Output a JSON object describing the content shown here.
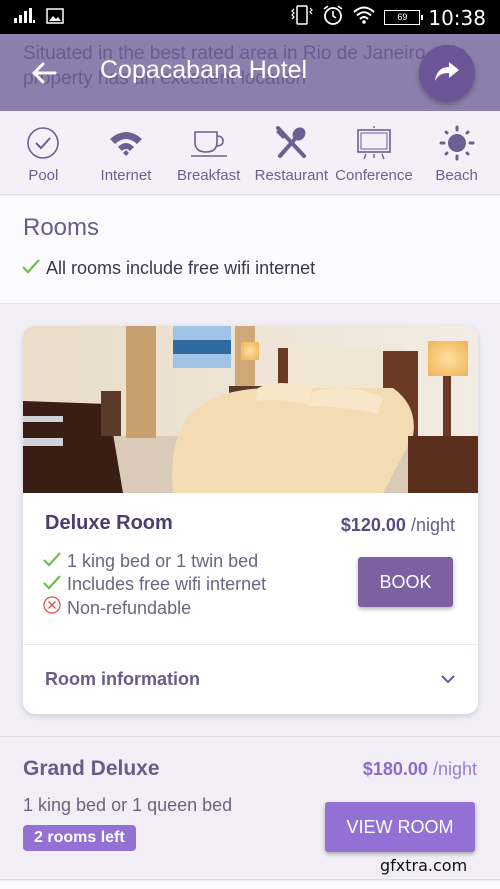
{
  "status_bar": {
    "time": "10:38",
    "battery": "69",
    "icons": [
      "signal-icon",
      "image-notification-icon",
      "vibrate-icon",
      "alarm-icon",
      "wifi-icon",
      "battery-icon"
    ]
  },
  "app_bar": {
    "title": "Copacabana Hotel",
    "behind_text": "Situated in the best rated area in Rio de Janeiro, this property has an excellent location",
    "back_icon": "arrow-back-icon",
    "share_icon": "share-icon"
  },
  "amenities": [
    {
      "label": "Pool",
      "icon": "check-circle-icon"
    },
    {
      "label": "Internet",
      "icon": "wifi-icon"
    },
    {
      "label": "Breakfast",
      "icon": "coffee-cup-icon"
    },
    {
      "label": "Restaurant",
      "icon": "cutlery-icon"
    },
    {
      "label": "Conference",
      "icon": "presentation-board-icon"
    },
    {
      "label": "Beach",
      "icon": "sun-icon"
    }
  ],
  "rooms": {
    "heading": "Rooms",
    "note": "All rooms include free wifi internet"
  },
  "deluxe": {
    "name": "Deluxe Room",
    "price": "$120.00",
    "per": "/night",
    "features": [
      {
        "text": "1 king bed or 1 twin bed",
        "type": "check"
      },
      {
        "text": "Includes free wifi internet",
        "type": "check"
      },
      {
        "text": "Non-refundable",
        "type": "cross"
      }
    ],
    "book_label": "BOOK",
    "info_label": "Room information"
  },
  "grand": {
    "name": "Grand Deluxe",
    "price": "$180.00",
    "per": "/night",
    "beds": "1 king bed or 1 queen bed",
    "badge": "2 rooms left",
    "view_label": "VIEW ROOM"
  },
  "watermark": "gfxtra.com",
  "colors": {
    "app_bar": "#8d7fad",
    "fab": "#6b5596",
    "primary_button": "#7b619f",
    "accent": "#9370d4",
    "check": "#6cc04a",
    "cross": "#d9534f"
  }
}
